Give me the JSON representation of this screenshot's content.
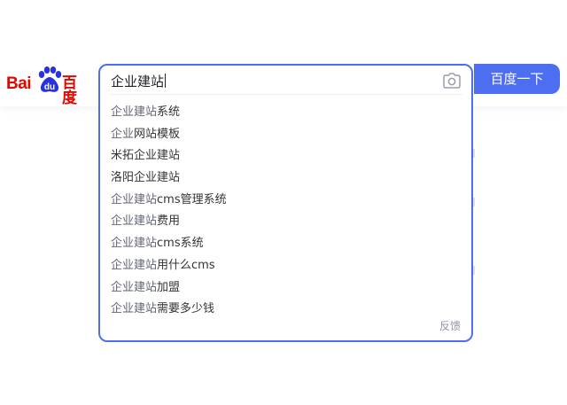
{
  "logo": {
    "text_latin": "Bai",
    "text_paw": "du",
    "text_cn": "百度"
  },
  "search": {
    "query": "企业建站",
    "button_label": "百度一下"
  },
  "suggestions": [
    {
      "prefix": "企业建站",
      "rest": "系统"
    },
    {
      "prefix": "企业",
      "rest": "网站模板"
    },
    {
      "prefix": "",
      "rest": "米拓企业建站"
    },
    {
      "prefix": "",
      "rest": "洛阳企业建站"
    },
    {
      "prefix": "企业建站",
      "rest": "cms管理系统"
    },
    {
      "prefix": "企业建站",
      "rest": "费用"
    },
    {
      "prefix": "企业建站",
      "rest": "cms系统"
    },
    {
      "prefix": "企业建站",
      "rest": "用什么cms"
    },
    {
      "prefix": "企业建站",
      "rest": "加盟"
    },
    {
      "prefix": "企业建站",
      "rest": "需要多少钱"
    }
  ],
  "feedback_label": "反馈",
  "colors": {
    "brand_red": "#e10601",
    "brand_blue": "#4e6ef2",
    "paw_blue": "#2932e1"
  },
  "icons": {
    "camera": "camera-icon",
    "paw": "paw-icon"
  }
}
